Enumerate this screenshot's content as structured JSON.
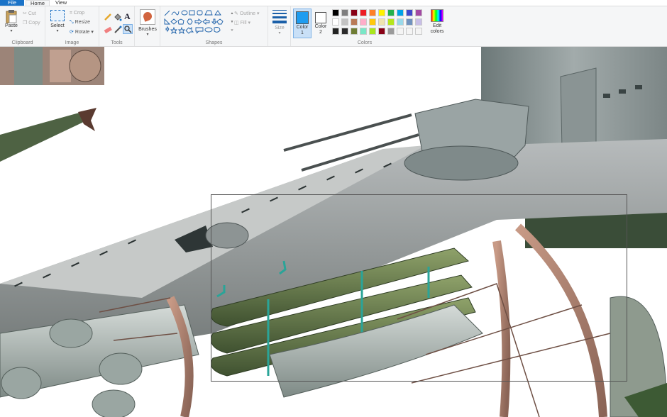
{
  "menu": {
    "file": "File",
    "home": "Home",
    "view": "View"
  },
  "clipboard": {
    "paste": "Paste",
    "cut": "Cut",
    "copy": "Copy",
    "label": "Clipboard"
  },
  "image": {
    "select": "Select",
    "crop": "Crop",
    "resize": "Resize",
    "rotate": "Rotate",
    "label": "Image"
  },
  "tools": {
    "label": "Tools"
  },
  "brushes": {
    "label": "Brushes"
  },
  "shapes": {
    "outline": "Outline",
    "fill": "Fill",
    "label": "Shapes"
  },
  "size": {
    "label": "Size"
  },
  "colors": {
    "color1": "Color",
    "color1_num": "1",
    "color2": "Color",
    "color2_num": "2",
    "edit": "Edit",
    "edit2": "colors",
    "label": "Colors",
    "color1_value": "#1e9cf0",
    "color2_value": "#ffffff",
    "palette_row1": [
      "#000000",
      "#7f7f7f",
      "#880015",
      "#ed1c24",
      "#ff7f27",
      "#fff200",
      "#22b14c",
      "#00a2e8",
      "#3f48cc",
      "#a349a4"
    ],
    "palette_row2": [
      "#ffffff",
      "#c3c3c3",
      "#b97a57",
      "#ffaec9",
      "#ffc90e",
      "#efe4b0",
      "#b5e61d",
      "#99d9ea",
      "#7092be",
      "#c8bfe7"
    ],
    "palette_row3": [
      "#222222",
      "#2b2b2b",
      "#6f7d35",
      "#7ae7c7",
      "#a8e61d",
      "#880015",
      "#9a9a9a",
      "#f4f4f4",
      "#f4f4f4",
      "#f4f4f4"
    ]
  }
}
